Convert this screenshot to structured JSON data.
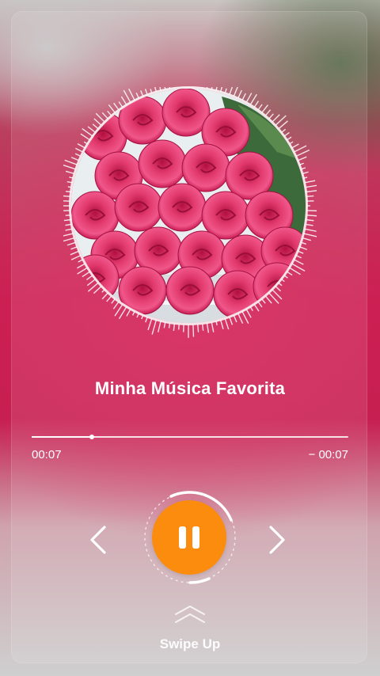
{
  "track": {
    "title": "Minha Música Favorita"
  },
  "player": {
    "elapsed": "00:07",
    "remaining": "− 00:07",
    "progress_fraction": 0.19,
    "state": "playing"
  },
  "controls": {
    "prev_icon": "chevron-left-icon",
    "play_pause_icon": "pause-icon",
    "next_icon": "chevron-right-icon",
    "accent_color": "#fb8c0e"
  },
  "footer": {
    "swipe_label": "Swipe Up",
    "swipe_icon": "double-chevron-up-icon"
  },
  "artwork": {
    "subject": "bouquet of pink roses"
  }
}
